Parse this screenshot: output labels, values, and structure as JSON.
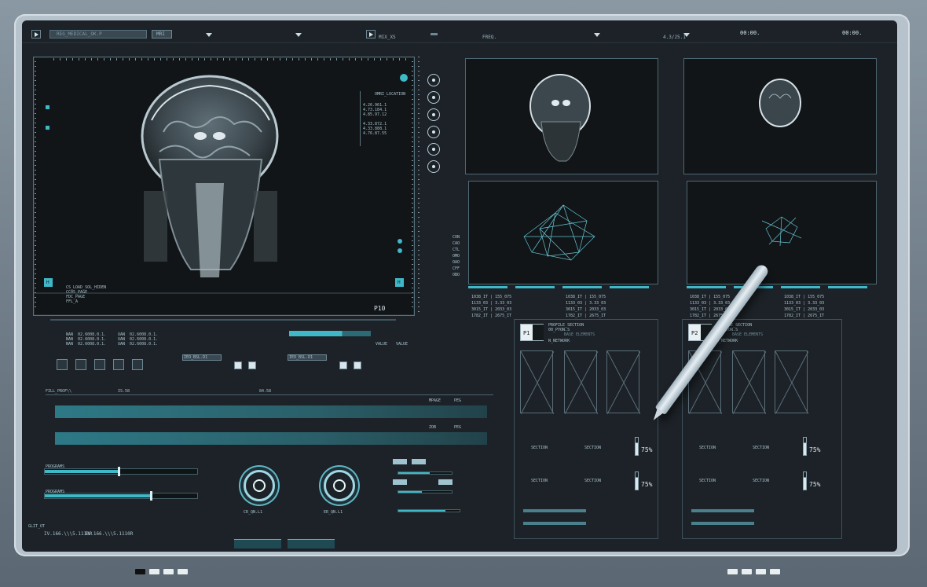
{
  "toolbar": {
    "title_field": "REG_MEDICAL_OK.P",
    "mode": "MRI",
    "mode2": "MIX_XS",
    "freq_label": "FREQ.",
    "ratio": "4.3/25.1",
    "time1": "00:00.",
    "time2": "00:00."
  },
  "left_viewer": {
    "readouts": [
      "4.26.961.1",
      "4.73.184.1",
      "4.85.97.12",
      "4.33.872.1",
      "4.33.888.1",
      "4.76.87.55"
    ],
    "readout_head": "OMRI_LOCATION",
    "bottom_text": [
      "CS_LOAD_SOL_HIDEN",
      "CC05_PAGE",
      "FDC_PAGE",
      "FFL_A"
    ],
    "corner_badge": "P10",
    "badge_letter": "H"
  },
  "side_labels": [
    "CON",
    "CAO",
    "CTL",
    "OMO",
    "OAO",
    "CFF",
    "OBO"
  ],
  "controls": {
    "col1": [
      "NAN  02.6008.0.1.",
      "NAN  02.6008.0.1.",
      "NAN  02.6008.0.1."
    ],
    "col2": [
      "UAN  02.6008.0.1.",
      "UAN  02.6008.0.1.",
      "UAN  02.6008.0.1."
    ],
    "field_a": "IEO_BSL.D1",
    "field_b": "IEO_BSL.D1",
    "value_a": "VALUE",
    "value_b": "VALUE",
    "fill_label": "FILL_PROF\\\\",
    "fill_val1": "IS.58",
    "fill_val2": "84.58",
    "track_a": "MPAGE",
    "track_b": "PEG",
    "track_c": "ZOB",
    "track_d": "PEG",
    "slider_a": "PROGRAMS",
    "slider_b": "PROGRAMS",
    "dial_a": "CR_QN.L1",
    "dial_b": "ER_QN.L1",
    "bottom_code1": "IV.166.\\\\\\5.1110R",
    "bottom_code2": "IV.166.\\\\\\5.1110R",
    "bottom_small": "GLIT_OT"
  },
  "profile_p1": {
    "badge": "P1",
    "title": "PROFILE_SECTION",
    "sub": "00_PYON.S",
    "sub2": "BASE ELEMENTS",
    "network": "N_NETWORK",
    "percent1": "75%",
    "percent2": "75%",
    "section_label": "SECTION",
    "table": [
      "1038_IT | 155_075",
      "1133_03 | 3.33_03",
      "3015_IT | 2033_03",
      "1782_IT | 2675_IT"
    ]
  },
  "profile_p2": {
    "badge": "P2",
    "title": "PROFILE_SECTION",
    "sub": "00_PYON.S",
    "sub2": "BASE ELEMENTS",
    "network": "N_NETWORK",
    "percent1": "75%",
    "percent2": "75%",
    "section_label": "SECTION",
    "table": [
      "1038_IT | 155_075",
      "1133_03 | 3.33_03",
      "3015_IT | 2033_03",
      "1782_IT | 2675_IT"
    ]
  },
  "colors": {
    "accent": "#3fb8c8",
    "panel": "#15191d",
    "screen": "#1c2227",
    "bezel": "#b7c3cc"
  },
  "icons": [
    "play-icon",
    "chevron-down-icon",
    "target-icon",
    "save-icon",
    "close-icon",
    "pencil-stylus"
  ]
}
